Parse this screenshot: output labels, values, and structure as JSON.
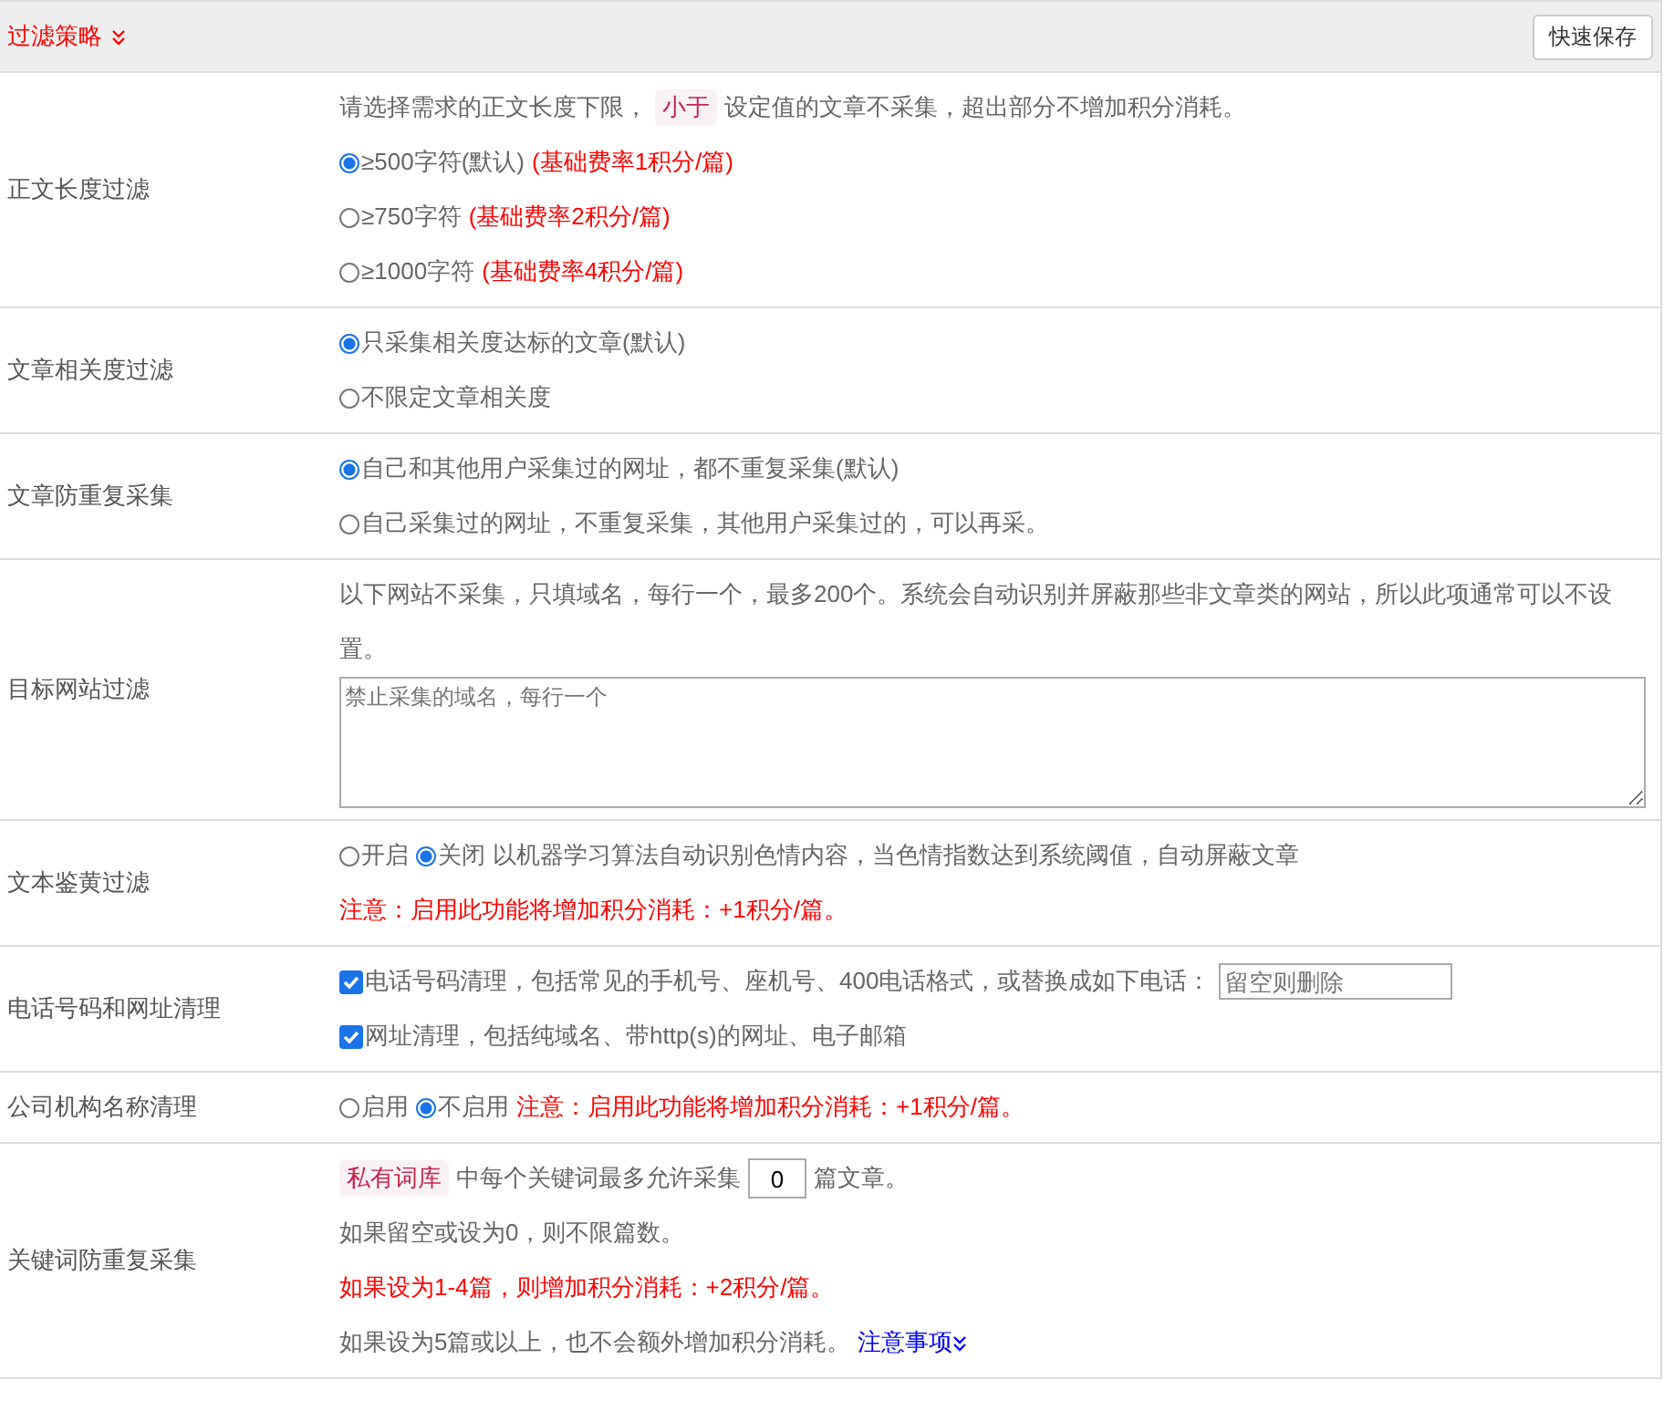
{
  "header": {
    "title": "过滤策略",
    "button": "快速保存"
  },
  "rows": [
    {
      "label": "正文长度过滤",
      "lines": [
        [
          {
            "kind": "text",
            "text": "请选择需求的正文长度下限，"
          },
          {
            "kind": "tag",
            "text": "小于"
          },
          {
            "kind": "text",
            "text": "设定值的文章不采集，超出部分不增加积分消耗。"
          }
        ],
        [
          {
            "kind": "radio",
            "text": "≥500字符(默认)",
            "selected": true
          },
          {
            "kind": "note",
            "text": "(基础费率1积分/篇)"
          }
        ],
        [
          {
            "kind": "radio",
            "text": "≥750字符",
            "selected": false
          },
          {
            "kind": "note",
            "text": "(基础费率2积分/篇)"
          }
        ],
        [
          {
            "kind": "radio",
            "text": "≥1000字符",
            "selected": false
          },
          {
            "kind": "note",
            "text": "(基础费率4积分/篇)"
          }
        ]
      ]
    },
    {
      "label": "文章相关度过滤",
      "lines": [
        [
          {
            "kind": "radio",
            "text": "只采集相关度达标的文章(默认)",
            "selected": true
          }
        ],
        [
          {
            "kind": "radio",
            "text": "不限定文章相关度",
            "selected": false
          }
        ]
      ]
    },
    {
      "label": "文章防重复采集",
      "lines": [
        [
          {
            "kind": "radio",
            "text": "自己和其他用户采集过的网址，都不重复采集(默认)",
            "selected": true
          }
        ],
        [
          {
            "kind": "radio",
            "text": "自己采集过的网址，不重复采集，其他用户采集过的，可以再采。",
            "selected": false
          }
        ]
      ]
    },
    {
      "label": "目标网站过滤",
      "lines": [
        [
          {
            "kind": "text",
            "text": "以下网站不采集，只填域名，每行一个，最多200个。系统会自动识别并屏蔽那些非文章类的网站，所以此项通常可以不设置。"
          }
        ],
        [
          {
            "kind": "textarea",
            "placeholder": "禁止采集的域名，每行一个"
          }
        ]
      ]
    },
    {
      "label": "文本鉴黄过滤",
      "lines": [
        [
          {
            "kind": "radio",
            "text": "开启",
            "selected": false
          },
          {
            "kind": "radio",
            "text": "关闭",
            "selected": true
          },
          {
            "kind": "text",
            "text": "以机器学习算法自动识别色情内容，当色情指数达到系统阈值，自动屏蔽文章"
          }
        ],
        [
          {
            "kind": "note",
            "text": "注意：启用此功能将增加积分消耗：+1积分/篇。"
          }
        ]
      ]
    },
    {
      "label": "电话号码和网址清理",
      "lines": [
        [
          {
            "kind": "checkbox",
            "text": "电话号码清理，包括常见的手机号、座机号、400电话格式，或替换成如下电话：",
            "checked": true
          },
          {
            "kind": "field",
            "placeholder": "留空则删除"
          }
        ],
        [
          {
            "kind": "checkbox",
            "text": "网址清理，包括纯域名、带http(s)的网址、电子邮箱",
            "checked": true
          }
        ]
      ]
    },
    {
      "label": "公司机构名称清理",
      "lines": [
        [
          {
            "kind": "radio",
            "text": "启用",
            "selected": false
          },
          {
            "kind": "radio",
            "text": "不启用",
            "selected": true
          },
          {
            "kind": "note",
            "text": "注意：启用此功能将增加积分消耗：+1积分/篇。"
          }
        ]
      ]
    },
    {
      "label": "关键词防重复采集",
      "lines": [
        [
          {
            "kind": "tag",
            "text": "私有词库"
          },
          {
            "kind": "text",
            "text": "中每个关键词最多允许采集"
          },
          {
            "kind": "number",
            "value": "0"
          },
          {
            "kind": "text",
            "text": "篇文章。"
          }
        ],
        [
          {
            "kind": "text",
            "text": "如果留空或设为0，则不限篇数。"
          }
        ],
        [
          {
            "kind": "note",
            "text": "如果设为1-4篇，则增加积分消耗：+2积分/篇。"
          }
        ],
        [
          {
            "kind": "text",
            "text": "如果设为5篇或以上，也不会额外增加积分消耗。"
          },
          {
            "kind": "link",
            "text": "注意事项"
          }
        ]
      ]
    }
  ]
}
